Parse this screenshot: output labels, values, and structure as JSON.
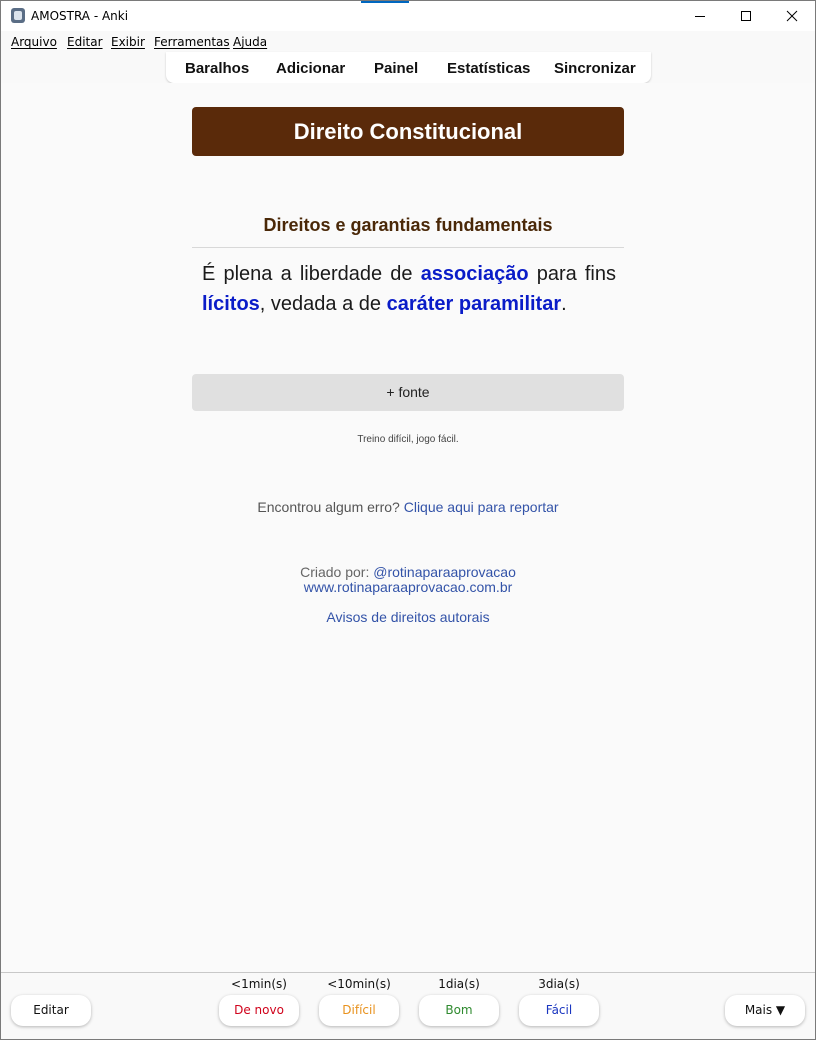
{
  "window": {
    "title": "AMOSTRA - Anki"
  },
  "menu": [
    "Arquivo",
    "Editar",
    "Exibir",
    "Ferramentas",
    "Ajuda"
  ],
  "toolbar": [
    "Baralhos",
    "Adicionar",
    "Painel",
    "Estatísticas",
    "Sincronizar"
  ],
  "card": {
    "deck_title": "Direito Constitucional",
    "subtitle": "Direitos e garantias fundamentais",
    "text_parts": [
      {
        "t": "É plena a liberdade de ",
        "hl": false
      },
      {
        "t": "associação",
        "hl": true
      },
      {
        "t": " para fins ",
        "hl": false
      },
      {
        "t": "lícitos",
        "hl": true
      },
      {
        "t": ", vedada a de ",
        "hl": false
      },
      {
        "t": "caráter paramilitar",
        "hl": true
      },
      {
        "t": ".",
        "hl": false
      }
    ],
    "source_button": "+ fonte",
    "motto": "Treino difícil, jogo fácil.",
    "error_prompt": "Encontrou algum erro?",
    "error_link": "Clique aqui para reportar",
    "creator_label": "Criado por:",
    "creator_handle": "@rotinaparaaprovacao",
    "creator_site": "www.rotinaparaaprovacao.com.br",
    "copyright_link": "Avisos de direitos autorais"
  },
  "bottom": {
    "edit_label": "Editar",
    "more_label": "Mais ▼",
    "answers": [
      {
        "interval": "<1min(s)",
        "label": "De novo",
        "color": "#d0021b"
      },
      {
        "interval": "<10min(s)",
        "label": "Difícil",
        "color": "#e8911c"
      },
      {
        "interval": "1dia(s)",
        "label": "Bom",
        "color": "#2f8a2f"
      },
      {
        "interval": "3dia(s)",
        "label": "Fácil",
        "color": "#1a36c0"
      }
    ]
  },
  "colors": {
    "header_bg": "#5a2a0a",
    "highlight": "#0a1cc8",
    "link": "#3353a8"
  }
}
